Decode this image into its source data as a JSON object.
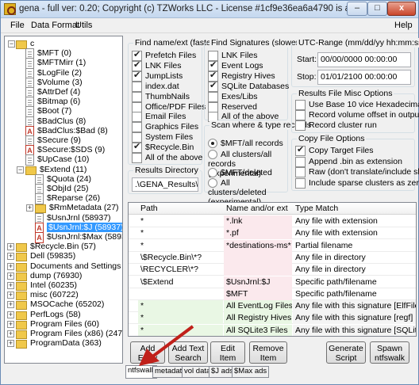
{
  "title": "gena - full ver: 0.20; Copyright (c) TZWorks LLC - License #1cf9e36ea6a4790 is authenticated for business use ...",
  "window_buttons": {
    "minimize": "–",
    "maximize": "□",
    "close": "x"
  },
  "menu": {
    "file": "File",
    "data_format": "Data Format",
    "utils": "Utils",
    "help": "Help"
  },
  "tree": {
    "root": "c",
    "items": [
      "$MFT (0)",
      "$MFTMirr (1)",
      "$LogFile (2)",
      "$Volume (3)",
      "$AttrDef (4)",
      "$Bitmap (6)",
      "$Boot (7)",
      "$BadClus (8)",
      "$BadClus:$Bad (8)",
      "$Secure (9)",
      "$Secure:$SDS (9)",
      "$UpCase (10)",
      "$Extend (11)",
      "$Quota (24)",
      "$ObjId (25)",
      "$Reparse (26)",
      "$RmMetadata (27)",
      "$UsnJrnl (58937)",
      "$UsnJrnl:$J (58937)",
      "$UsnJrnl:$Max (58937)",
      "$Recycle.Bin (57)",
      "Dell (59835)",
      "Documents and Settings (13",
      "dump (76930)",
      "Intel (60235)",
      "misc (60722)",
      "MSOCache (65202)",
      "PerfLogs (58)",
      "Program Files (60)",
      "Program Files (x86) (247)",
      "ProgramData (363)"
    ]
  },
  "find_name": {
    "label": "Find name/ext (faster)",
    "items": [
      {
        "label": "Prefetch Files",
        "checked": true
      },
      {
        "label": "LNK Files",
        "checked": true
      },
      {
        "label": "JumpLists",
        "checked": true
      },
      {
        "label": "index.dat",
        "checked": false
      },
      {
        "label": "ThumbNails",
        "checked": false
      },
      {
        "label": "Office/PDF Files",
        "checked": false
      },
      {
        "label": "Email Files",
        "checked": false
      },
      {
        "label": "Graphics Files",
        "checked": false
      },
      {
        "label": "System Files",
        "checked": false
      },
      {
        "label": "$Recycle.Bin",
        "checked": true
      },
      {
        "label": "All of the above",
        "checked": false
      }
    ]
  },
  "find_sig": {
    "label": "Find Signatures (slower)",
    "items": [
      {
        "label": "LNK Files",
        "checked": false
      },
      {
        "label": "Event Logs",
        "checked": true
      },
      {
        "label": "Registry Hives",
        "checked": true
      },
      {
        "label": "SQLite Databases",
        "checked": true
      },
      {
        "label": "Exes/Libs",
        "checked": false
      },
      {
        "label": "Reserved",
        "checked": false
      },
      {
        "label": "All of the above",
        "checked": false
      }
    ]
  },
  "scan": {
    "label": "Scan where & type records",
    "options": [
      "$MFT/all records",
      "All clusters/all records (experimental)",
      "$MFT/deleted",
      "All clusters/deleted (experimental)"
    ]
  },
  "utc": {
    "label": "UTC-Range (mm/dd/yy hh:mm:ss)",
    "start_label": "Start:",
    "start": "00/00/0000 00:00:00",
    "stop_label": "Stop:",
    "stop": "01/01/2100 00:00:00"
  },
  "results_misc": {
    "label": "Results File Misc Options",
    "items": [
      {
        "label": "Use Base 10 vice Hexadecimal",
        "checked": false
      },
      {
        "label": "Record volume offset in output",
        "checked": false
      },
      {
        "label": "Record cluster run",
        "checked": false
      }
    ]
  },
  "copy_opts": {
    "label": "Copy File Options",
    "items": [
      {
        "label": "Copy Target Files",
        "checked": true
      },
      {
        "label": "Append .bin as extension",
        "checked": false
      },
      {
        "label": "Raw (don't translate/include slack)",
        "checked": false
      },
      {
        "label": "Include sparse clusters as zeros",
        "checked": false
      }
    ]
  },
  "results_dir": {
    "label": "Results Directory",
    "value": ".\\GENA_Results\\"
  },
  "grid": {
    "headers": [
      "Path",
      "Name and/or ext",
      "Type Match"
    ],
    "rows": [
      [
        "*",
        "*.lnk",
        "Any file with extension"
      ],
      [
        "*",
        "*.pf",
        "Any file with extension"
      ],
      [
        "*",
        "*destinations-ms*",
        "Partial filename"
      ],
      [
        "\\$Recycle.Bin\\*?",
        "",
        "Any file in directory"
      ],
      [
        "\\RECYCLER\\*?",
        "",
        "Any file in directory"
      ],
      [
        "\\$Extend",
        "$UsnJrnl:$J",
        "Specific path/filename"
      ],
      [
        "",
        "$MFT",
        "Specific path/filename"
      ],
      [
        "*",
        "All EventLog Files",
        "Any file with this signature [ElfFile or 30"
      ],
      [
        "*",
        "All Registry Hives",
        "Any file with this signature [regf]"
      ],
      [
        "*",
        "All SQLite3 Files",
        "Any file with this signature [SQLite]"
      ]
    ]
  },
  "buttons": {
    "add": "Add\nEntry",
    "add_text": "Add Text\nSearch",
    "edit": "Edit\nItem",
    "remove": "Remove\nItem",
    "generate": "Generate\nScript",
    "spawn": "Spawn\nntfswalk"
  },
  "tabs": [
    "ntfswalk",
    "metadata",
    "vol data",
    "$J ads",
    "$Max ads"
  ],
  "colors": {
    "accent": "#3399ff",
    "arrow": "#c0201a"
  }
}
